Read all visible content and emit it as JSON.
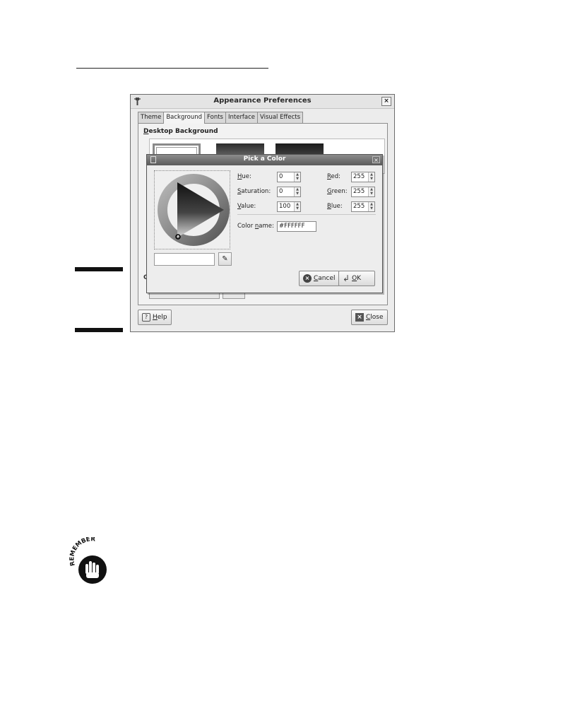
{
  "appearance_window": {
    "title": "Appearance Preferences",
    "tabs": [
      "Theme",
      "Background",
      "Fonts",
      "Interface",
      "Visual Effects"
    ],
    "active_tab": "Background",
    "section_label_u": "D",
    "section_label_rest": "esktop Background",
    "partial_label": "C",
    "help_label_u": "H",
    "help_label_rest": "elp",
    "close_label_u": "C",
    "close_label_rest": "lose"
  },
  "color_dialog": {
    "title": "Pick a Color",
    "hue_label_u": "H",
    "hue_label_rest": "ue:",
    "hue_value": "0",
    "saturation_label_u": "S",
    "saturation_label_rest": "aturation:",
    "saturation_value": "0",
    "value_label_u": "V",
    "value_label_rest": "alue:",
    "value_value": "100",
    "red_label_u": "R",
    "red_label_rest": "ed:",
    "red_value": "255",
    "green_label_u": "G",
    "green_label_rest": "reen:",
    "green_value": "255",
    "blue_label_u": "B",
    "blue_label_rest": "lue:",
    "blue_value": "255",
    "color_name_label_pre": "Color ",
    "color_name_label_u": "n",
    "color_name_label_rest": "ame:",
    "color_name_value": "#FFFFFF",
    "hex_entry_value": "",
    "cancel_label_u": "C",
    "cancel_label_rest": "ancel",
    "ok_label_u": "O",
    "ok_label_rest": "K"
  },
  "remember_icon_text": "REMEMBER",
  "colors": {
    "selected_color": "#FFFFFF",
    "dialog_title_bar": "#5a5a5a"
  }
}
